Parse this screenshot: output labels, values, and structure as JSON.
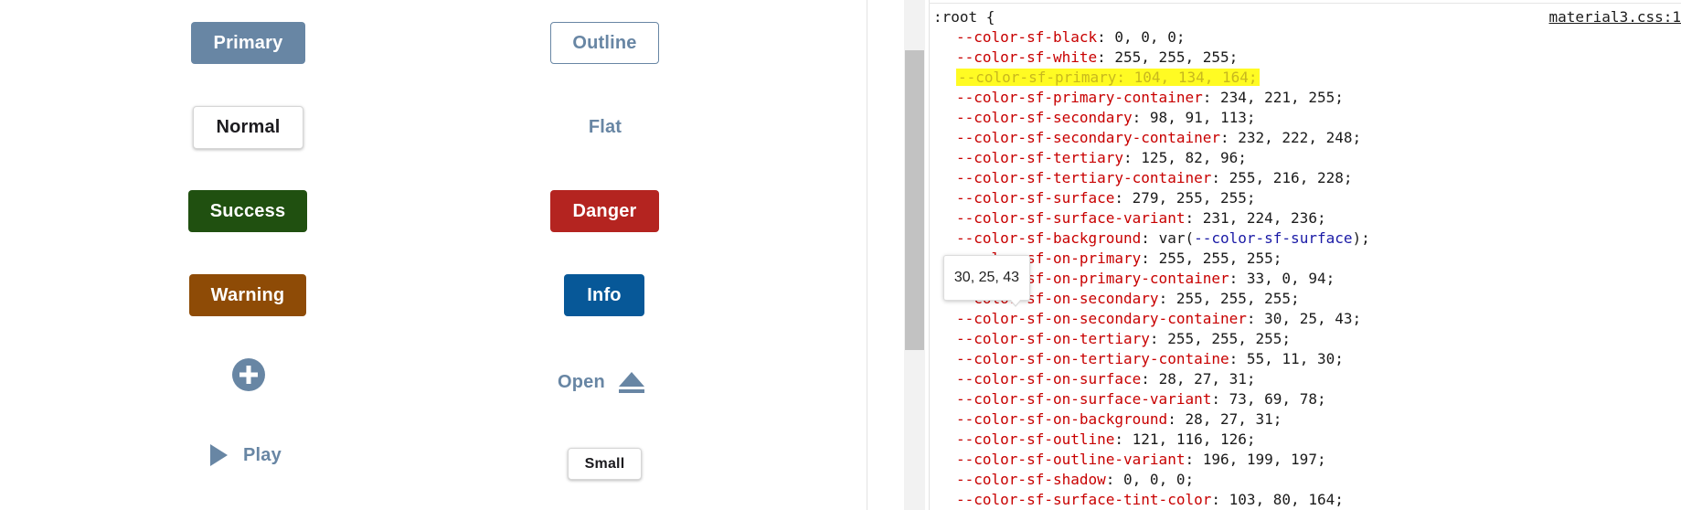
{
  "colors": {
    "primary": "#6886a4",
    "success": "#205010",
    "danger": "#b42420",
    "warning": "#8e4b06",
    "info": "#075898",
    "highlight": "#fffb23",
    "property": "#c80000",
    "variable_ref": "#1a1aa6"
  },
  "buttons": {
    "primary": "Primary",
    "outline": "Outline",
    "normal": "Normal",
    "flat": "Flat",
    "success": "Success",
    "danger": "Danger",
    "warning": "Warning",
    "info": "Info",
    "fab_icon": "plus-circle-icon",
    "open": "Open",
    "open_icon": "eject-icon",
    "play": "Play",
    "play_icon": "play-icon",
    "small": "Small"
  },
  "code": {
    "file_link": "material3.css:1",
    "selector": ":root {",
    "lines": [
      {
        "prop": "--color-sf-black",
        "sep": ": ",
        "value": "0, 0, 0;"
      },
      {
        "prop": "--color-sf-white",
        "sep": ": ",
        "value": "255, 255, 255;"
      },
      {
        "prop": "--color-sf-primary",
        "sep": ": ",
        "value": "104, 134, 164;",
        "highlighted": true
      },
      {
        "prop": "--color-sf-primary-container",
        "sep": ": ",
        "value": "234, 221, 255;"
      },
      {
        "prop": "--color-sf-secondary",
        "sep": ": ",
        "value": "98, 91, 113;"
      },
      {
        "prop": "--color-sf-secondary-container",
        "sep": ": ",
        "value": "232, 222, 248;"
      },
      {
        "prop": "--color-sf-tertiary",
        "sep": ": ",
        "value": "125, 82, 96;"
      },
      {
        "prop": "--color-sf-tertiary-container",
        "sep": ": ",
        "value": "255, 216, 228;"
      },
      {
        "prop": "--color-sf-surface",
        "sep": ": ",
        "value": "279, 255, 255;"
      },
      {
        "prop": "--color-sf-surface-variant",
        "sep": ": ",
        "value": "231, 224, 236;"
      },
      {
        "prop": "--color-sf-background",
        "sep": ": ",
        "value_pre": "var(",
        "value_ref": "--color-sf-surface",
        "value_post": ");"
      },
      {
        "prop": "--color-sf-on-primary",
        "sep": ": ",
        "value": "255, 255, 255;"
      },
      {
        "prop": "--color-sf-on-primary-container",
        "sep": ": ",
        "value": "33, 0, 94;"
      },
      {
        "prop": "--color-sf-on-secondary",
        "sep": ": ",
        "value": "255, 255, 255;"
      },
      {
        "prop": "--color-sf-on-secondary-container",
        "sep": ": ",
        "value": "30, 25, 43;"
      },
      {
        "prop": "--color-sf-on-tertiary",
        "sep": ": ",
        "value": "255, 255, 255;"
      },
      {
        "prop": "--color-sf-on-tertiary-containe",
        "sep": ": ",
        "value": "55, 11, 30;"
      },
      {
        "prop": "--color-sf-on-surface",
        "sep": ": ",
        "value": "28, 27, 31;"
      },
      {
        "prop": "--color-sf-on-surface-variant",
        "sep": ": ",
        "value": "73, 69, 78;"
      },
      {
        "prop": "--color-sf-on-background",
        "sep": ": ",
        "value": "28, 27, 31;"
      },
      {
        "prop": "--color-sf-outline",
        "sep": ": ",
        "value": "121, 116, 126;"
      },
      {
        "prop": "--color-sf-outline-variant",
        "sep": ": ",
        "value": "196, 199, 197;"
      },
      {
        "prop": "--color-sf-shadow",
        "sep": ": ",
        "value": "0, 0, 0;"
      },
      {
        "prop": "--color-sf-surface-tint-color",
        "sep": ": ",
        "value": "103, 80, 164;"
      }
    ]
  },
  "tooltip": {
    "text": "30, 25, 43"
  }
}
